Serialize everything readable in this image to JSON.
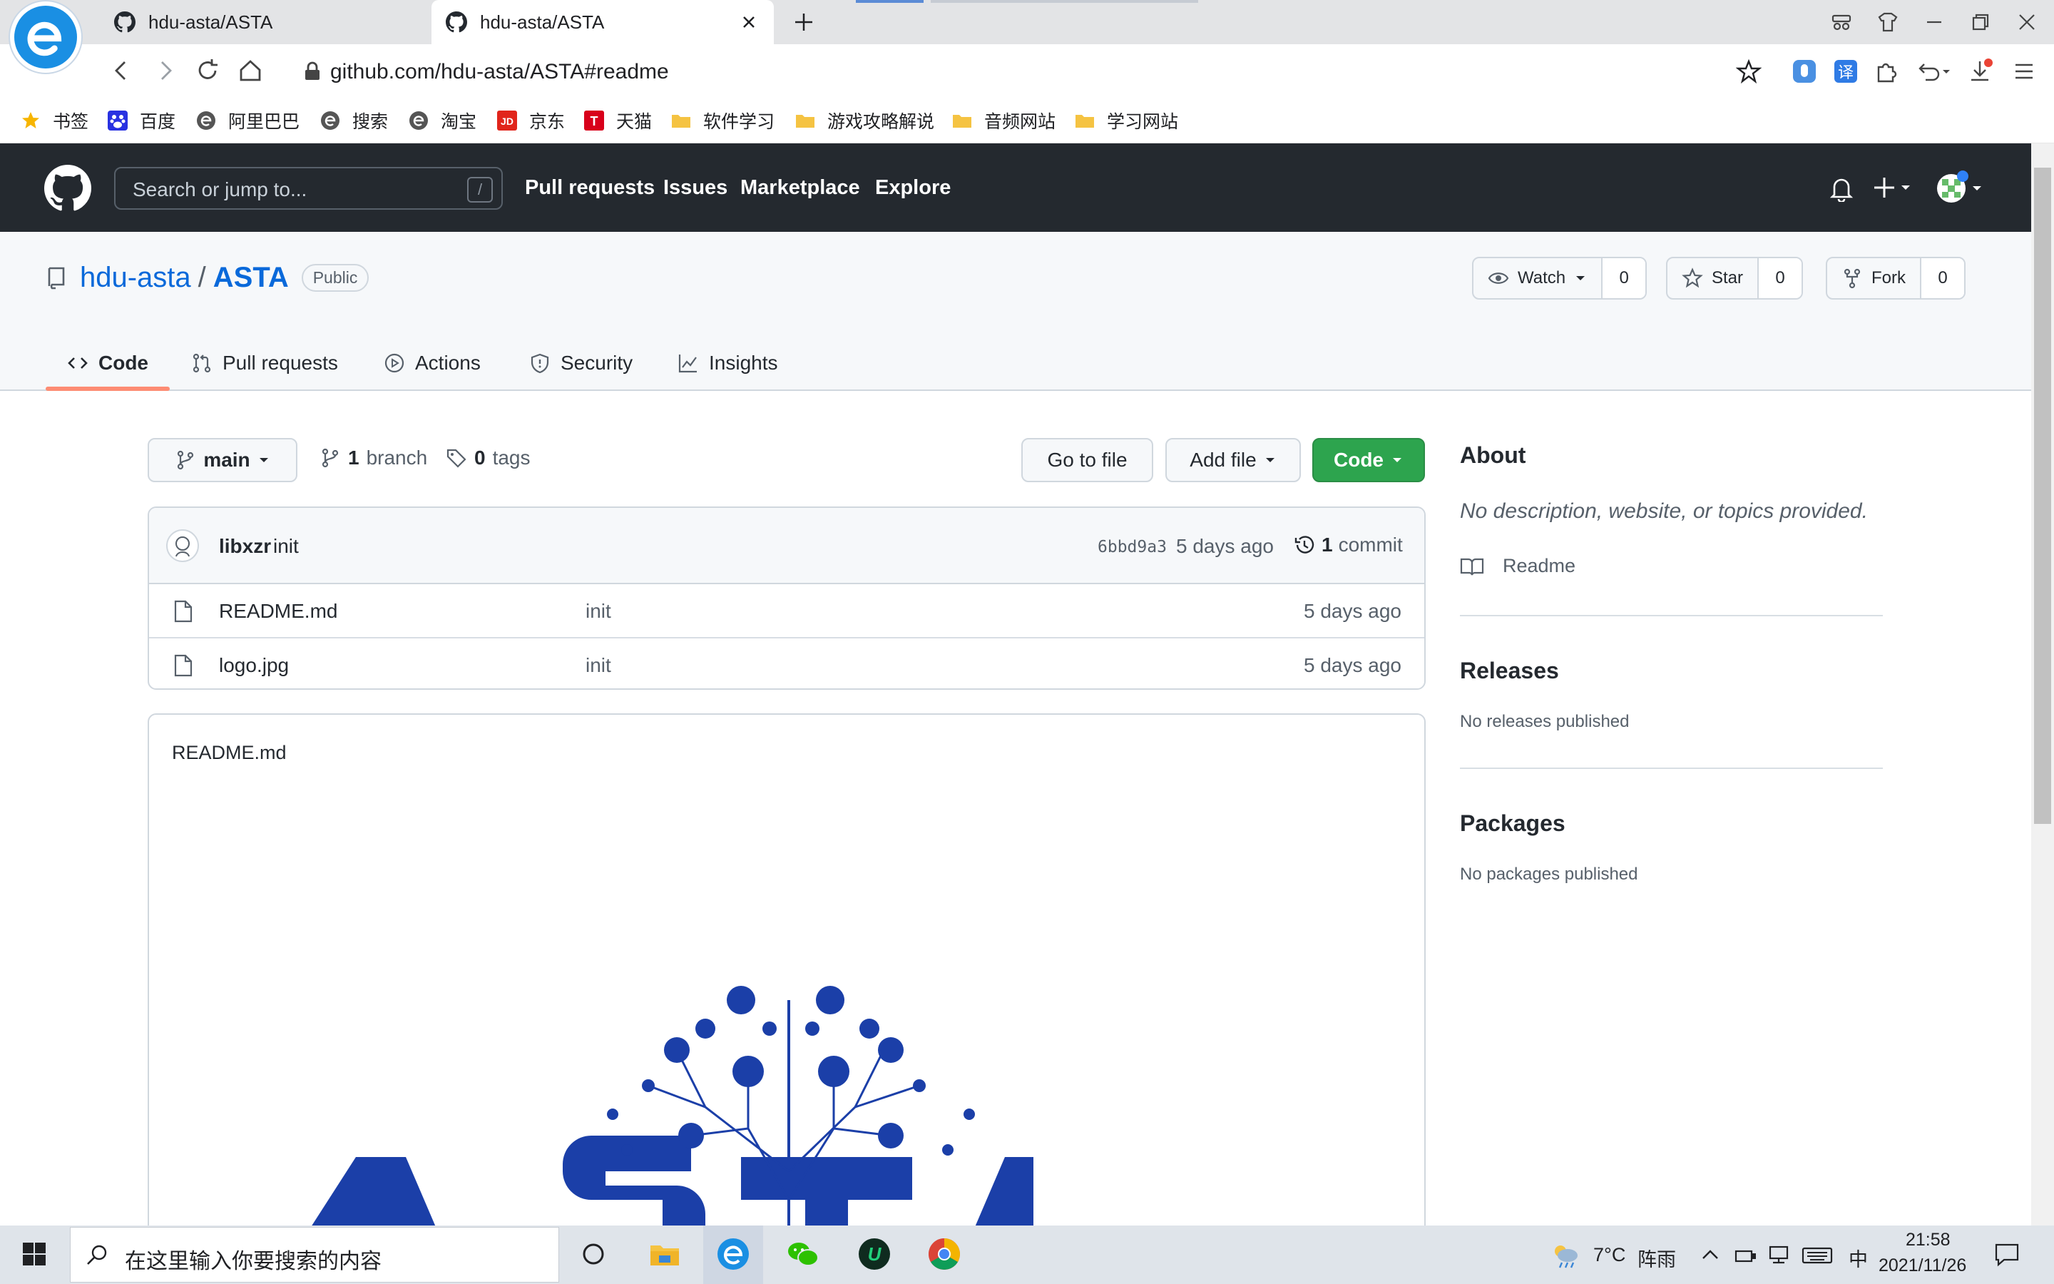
{
  "browser": {
    "tabs": [
      {
        "title": "hdu-asta/ASTA",
        "active": false
      },
      {
        "title": "hdu-asta/ASTA",
        "active": true
      }
    ],
    "url": "github.com/hdu-asta/ASTA#readme",
    "bookmarks": [
      "书签",
      "百度",
      "阿里巴巴",
      "搜索",
      "淘宝",
      "京东",
      "天猫",
      "软件学习",
      "游戏攻略解说",
      "音频网站",
      "学习网站"
    ]
  },
  "github": {
    "search_placeholder": "Search or jump to...",
    "search_shortcut": "/",
    "nav": [
      "Pull requests",
      "Issues",
      "Marketplace",
      "Explore"
    ]
  },
  "repo": {
    "owner": "hdu-asta",
    "separator": "/",
    "name": "ASTA",
    "visibility": "Public",
    "watch": {
      "label": "Watch",
      "count": "0"
    },
    "star": {
      "label": "Star",
      "count": "0"
    },
    "fork": {
      "label": "Fork",
      "count": "0"
    },
    "tabs": [
      "Code",
      "Pull requests",
      "Actions",
      "Security",
      "Insights"
    ],
    "active_tab": "Code"
  },
  "toolbar": {
    "branch": "main",
    "branch_count": "1",
    "branch_label": "branch",
    "tag_count": "0",
    "tag_label": "tags",
    "goto_file": "Go to file",
    "add_file": "Add file",
    "code": "Code"
  },
  "commit": {
    "author": "libxzr",
    "message": "init",
    "sha": "6bbd9a3",
    "time": "5 days ago",
    "count": "1",
    "count_label": "commit"
  },
  "files": [
    {
      "name": "README.md",
      "message": "init",
      "time": "5 days ago"
    },
    {
      "name": "logo.jpg",
      "message": "init",
      "time": "5 days ago"
    }
  ],
  "readme": {
    "title": "README.md"
  },
  "sidebar": {
    "about_title": "About",
    "about_desc": "No description, website, or topics provided.",
    "readme_link": "Readme",
    "releases_title": "Releases",
    "releases_text": "No releases published",
    "packages_title": "Packages",
    "packages_text": "No packages published"
  },
  "taskbar": {
    "search_placeholder": "在这里输入你要搜索的内容",
    "weather_temp": "7°C",
    "weather_text": "阵雨",
    "ime": "中",
    "time": "21:58",
    "date": "2021/11/26"
  },
  "colors": {
    "gh_header": "#24292f",
    "link": "#0969da",
    "code_button": "#2da44e",
    "tab_underline": "#fd8c73",
    "logo_blue": "#1b3fa8"
  }
}
